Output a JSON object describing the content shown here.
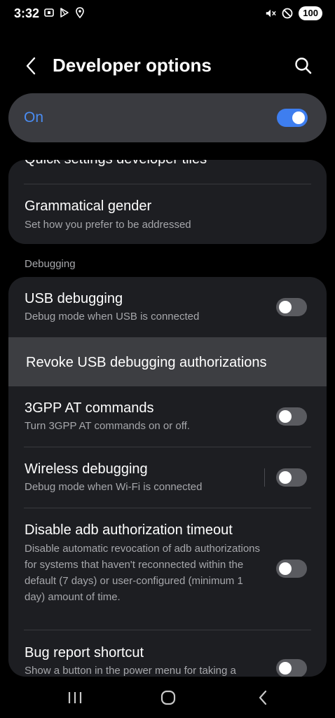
{
  "status_bar": {
    "time": "3:32",
    "battery": "100"
  },
  "header": {
    "title": "Developer options"
  },
  "master": {
    "label": "On",
    "enabled": true
  },
  "card1": {
    "partial_title": "Quick settings developer tiles",
    "grammatical_gender": {
      "title": "Grammatical gender",
      "subtitle": "Set how you prefer to be addressed"
    }
  },
  "section": {
    "debugging": "Debugging"
  },
  "items": {
    "usb_debugging": {
      "title": "USB debugging",
      "subtitle": "Debug mode when USB is connected",
      "enabled": false
    },
    "revoke": {
      "title": "Revoke USB debugging authorizations"
    },
    "at_commands": {
      "title": "3GPP AT commands",
      "subtitle": "Turn 3GPP AT commands on or off.",
      "enabled": false
    },
    "wireless": {
      "title": "Wireless debugging",
      "subtitle": "Debug mode when Wi-Fi is connected",
      "enabled": false
    },
    "adb_timeout": {
      "title": "Disable adb authorization timeout",
      "subtitle": "Disable automatic revocation of adb authorizations for systems that haven't reconnected within the default (7 days) or user-configured (minimum 1 day) amount of time.",
      "enabled": false
    },
    "bug_report": {
      "title": "Bug report shortcut",
      "subtitle": "Show a button in the power menu for taking a",
      "enabled": false
    }
  },
  "colors": {
    "accent": "#3e7eef",
    "on_label": "#4a8cf2",
    "background": "#000000",
    "card": "#1d1e22"
  }
}
